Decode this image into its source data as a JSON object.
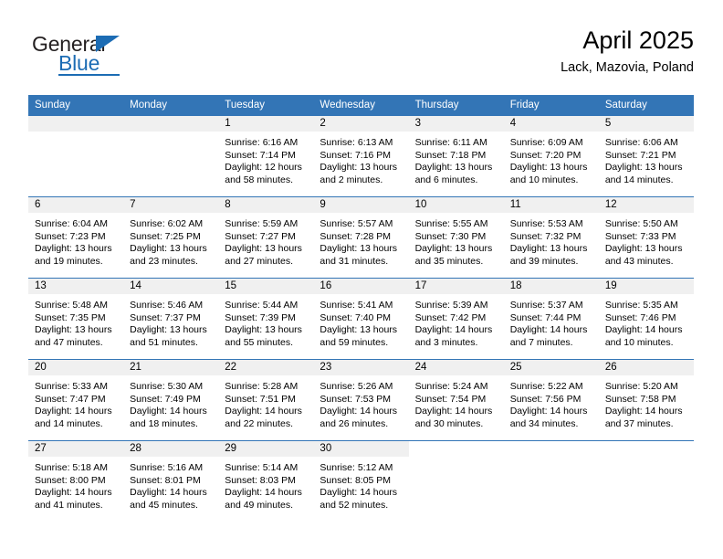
{
  "brand": {
    "name_part1": "General",
    "name_part2": "Blue"
  },
  "header": {
    "title": "April 2025",
    "subtitle": "Lack, Mazovia, Poland"
  },
  "colors": {
    "header_blue": "#3375b6",
    "brand_blue": "#1c6cb4",
    "daynum_band": "#f0f0f0"
  },
  "weekdays": [
    "Sunday",
    "Monday",
    "Tuesday",
    "Wednesday",
    "Thursday",
    "Friday",
    "Saturday"
  ],
  "weeks": [
    [
      {
        "day": "",
        "lines": []
      },
      {
        "day": "",
        "lines": []
      },
      {
        "day": "1",
        "lines": [
          "Sunrise: 6:16 AM",
          "Sunset: 7:14 PM",
          "Daylight: 12 hours and 58 minutes."
        ]
      },
      {
        "day": "2",
        "lines": [
          "Sunrise: 6:13 AM",
          "Sunset: 7:16 PM",
          "Daylight: 13 hours and 2 minutes."
        ]
      },
      {
        "day": "3",
        "lines": [
          "Sunrise: 6:11 AM",
          "Sunset: 7:18 PM",
          "Daylight: 13 hours and 6 minutes."
        ]
      },
      {
        "day": "4",
        "lines": [
          "Sunrise: 6:09 AM",
          "Sunset: 7:20 PM",
          "Daylight: 13 hours and 10 minutes."
        ]
      },
      {
        "day": "5",
        "lines": [
          "Sunrise: 6:06 AM",
          "Sunset: 7:21 PM",
          "Daylight: 13 hours and 14 minutes."
        ]
      }
    ],
    [
      {
        "day": "6",
        "lines": [
          "Sunrise: 6:04 AM",
          "Sunset: 7:23 PM",
          "Daylight: 13 hours and 19 minutes."
        ]
      },
      {
        "day": "7",
        "lines": [
          "Sunrise: 6:02 AM",
          "Sunset: 7:25 PM",
          "Daylight: 13 hours and 23 minutes."
        ]
      },
      {
        "day": "8",
        "lines": [
          "Sunrise: 5:59 AM",
          "Sunset: 7:27 PM",
          "Daylight: 13 hours and 27 minutes."
        ]
      },
      {
        "day": "9",
        "lines": [
          "Sunrise: 5:57 AM",
          "Sunset: 7:28 PM",
          "Daylight: 13 hours and 31 minutes."
        ]
      },
      {
        "day": "10",
        "lines": [
          "Sunrise: 5:55 AM",
          "Sunset: 7:30 PM",
          "Daylight: 13 hours and 35 minutes."
        ]
      },
      {
        "day": "11",
        "lines": [
          "Sunrise: 5:53 AM",
          "Sunset: 7:32 PM",
          "Daylight: 13 hours and 39 minutes."
        ]
      },
      {
        "day": "12",
        "lines": [
          "Sunrise: 5:50 AM",
          "Sunset: 7:33 PM",
          "Daylight: 13 hours and 43 minutes."
        ]
      }
    ],
    [
      {
        "day": "13",
        "lines": [
          "Sunrise: 5:48 AM",
          "Sunset: 7:35 PM",
          "Daylight: 13 hours and 47 minutes."
        ]
      },
      {
        "day": "14",
        "lines": [
          "Sunrise: 5:46 AM",
          "Sunset: 7:37 PM",
          "Daylight: 13 hours and 51 minutes."
        ]
      },
      {
        "day": "15",
        "lines": [
          "Sunrise: 5:44 AM",
          "Sunset: 7:39 PM",
          "Daylight: 13 hours and 55 minutes."
        ]
      },
      {
        "day": "16",
        "lines": [
          "Sunrise: 5:41 AM",
          "Sunset: 7:40 PM",
          "Daylight: 13 hours and 59 minutes."
        ]
      },
      {
        "day": "17",
        "lines": [
          "Sunrise: 5:39 AM",
          "Sunset: 7:42 PM",
          "Daylight: 14 hours and 3 minutes."
        ]
      },
      {
        "day": "18",
        "lines": [
          "Sunrise: 5:37 AM",
          "Sunset: 7:44 PM",
          "Daylight: 14 hours and 7 minutes."
        ]
      },
      {
        "day": "19",
        "lines": [
          "Sunrise: 5:35 AM",
          "Sunset: 7:46 PM",
          "Daylight: 14 hours and 10 minutes."
        ]
      }
    ],
    [
      {
        "day": "20",
        "lines": [
          "Sunrise: 5:33 AM",
          "Sunset: 7:47 PM",
          "Daylight: 14 hours and 14 minutes."
        ]
      },
      {
        "day": "21",
        "lines": [
          "Sunrise: 5:30 AM",
          "Sunset: 7:49 PM",
          "Daylight: 14 hours and 18 minutes."
        ]
      },
      {
        "day": "22",
        "lines": [
          "Sunrise: 5:28 AM",
          "Sunset: 7:51 PM",
          "Daylight: 14 hours and 22 minutes."
        ]
      },
      {
        "day": "23",
        "lines": [
          "Sunrise: 5:26 AM",
          "Sunset: 7:53 PM",
          "Daylight: 14 hours and 26 minutes."
        ]
      },
      {
        "day": "24",
        "lines": [
          "Sunrise: 5:24 AM",
          "Sunset: 7:54 PM",
          "Daylight: 14 hours and 30 minutes."
        ]
      },
      {
        "day": "25",
        "lines": [
          "Sunrise: 5:22 AM",
          "Sunset: 7:56 PM",
          "Daylight: 14 hours and 34 minutes."
        ]
      },
      {
        "day": "26",
        "lines": [
          "Sunrise: 5:20 AM",
          "Sunset: 7:58 PM",
          "Daylight: 14 hours and 37 minutes."
        ]
      }
    ],
    [
      {
        "day": "27",
        "lines": [
          "Sunrise: 5:18 AM",
          "Sunset: 8:00 PM",
          "Daylight: 14 hours and 41 minutes."
        ]
      },
      {
        "day": "28",
        "lines": [
          "Sunrise: 5:16 AM",
          "Sunset: 8:01 PM",
          "Daylight: 14 hours and 45 minutes."
        ]
      },
      {
        "day": "29",
        "lines": [
          "Sunrise: 5:14 AM",
          "Sunset: 8:03 PM",
          "Daylight: 14 hours and 49 minutes."
        ]
      },
      {
        "day": "30",
        "lines": [
          "Sunrise: 5:12 AM",
          "Sunset: 8:05 PM",
          "Daylight: 14 hours and 52 minutes."
        ]
      },
      {
        "day": "",
        "lines": []
      },
      {
        "day": "",
        "lines": []
      },
      {
        "day": "",
        "lines": []
      }
    ]
  ]
}
